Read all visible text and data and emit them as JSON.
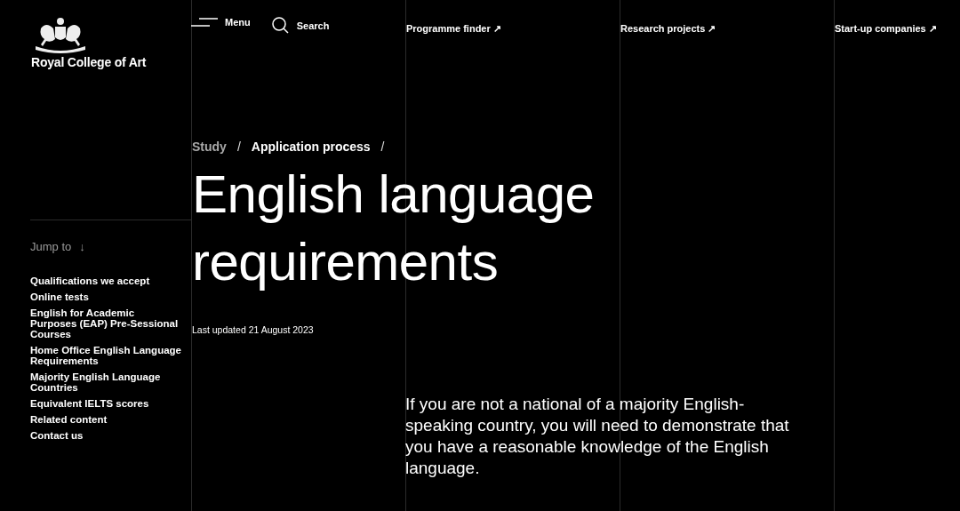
{
  "logo": {
    "name": "Royal College of Art"
  },
  "header": {
    "menu": "Menu",
    "search": "Search"
  },
  "nav_links": [
    {
      "label": "Programme finder",
      "arrow": "↗"
    },
    {
      "label": "Research projects",
      "arrow": "↗"
    },
    {
      "label": "Start-up companies",
      "arrow": "↗"
    }
  ],
  "sidebar": {
    "jump_to": "Jump to",
    "jump_arrow": "↓",
    "items": [
      "Qualifications we accept",
      "Online tests",
      "English for Academic Purposes (EAP) Pre-Sessional Courses",
      "Home Office English Language Requirements",
      "Majority English Language Countries",
      "Equivalent IELTS scores",
      "Related content",
      "Contact us"
    ]
  },
  "breadcrumb": {
    "separator": "/",
    "items": [
      {
        "label": "Study",
        "muted": true
      },
      {
        "label": "Application process",
        "muted": false
      }
    ]
  },
  "title": "English language requirements",
  "last_updated": "Last updated 21 August 2023",
  "intro": "If you are not a national of a majority English-speaking country, you will need to demonstrate that you have a reasonable knowledge of the English language."
}
